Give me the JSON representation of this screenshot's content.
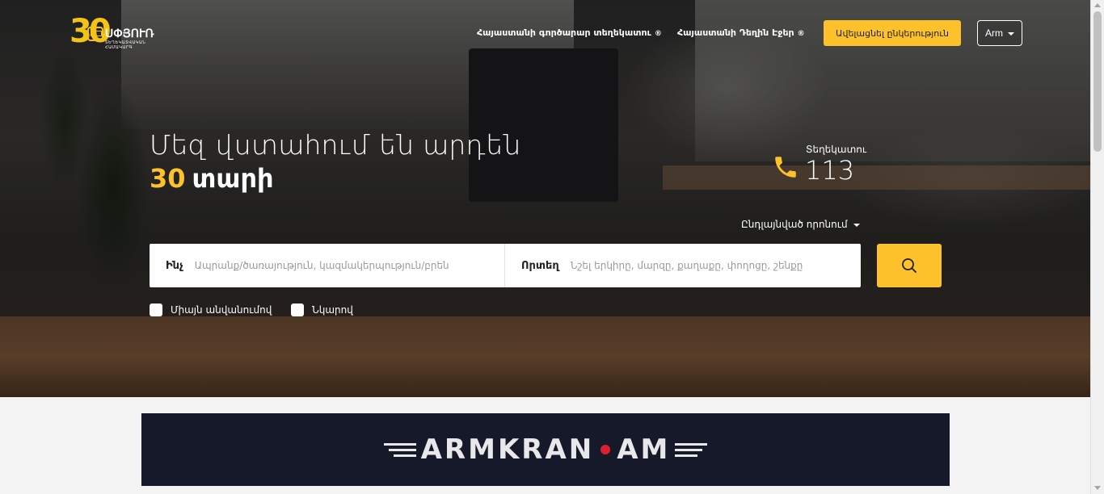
{
  "header": {
    "logo_number": "30",
    "logo_brand": "ՍՓՅՈՒՌ",
    "logo_tagline": "ՏԵՂԵԿԱՏՎԱԿԱՆ ՀԱՄԱԿԱՐԳ",
    "nav": [
      {
        "label": "Հայաստանի գործարար տեղեկատու",
        "suffix": "®"
      },
      {
        "label": "Հայաստանի Դեղին Էջեր",
        "suffix": "®"
      }
    ],
    "cta_label": "Ավելացնել ընկերություն",
    "language": "Arm"
  },
  "hero": {
    "headline_line1": "Մեզ վստահում են արդեն",
    "headline_number": "30",
    "headline_word": "տարի",
    "info_label": "Տեղեկատու",
    "info_number": "113",
    "advanced_search": "Ընդլայնված որոնում"
  },
  "search": {
    "what_label": "Ինչ",
    "what_placeholder": "Ապրանք/ծառայություն, կազմակերպություն/բրեն",
    "where_label": "Որտեղ",
    "where_placeholder": "Նշել երկիրը, մարզը, քաղաքը, փողոցը, շենքը"
  },
  "filters": [
    {
      "label": "Միայն անվանումով",
      "checked": false
    },
    {
      "label": "Նկարով",
      "checked": false
    }
  ],
  "banner": {
    "left": "ARMKRAN",
    "right": "AM"
  },
  "colors": {
    "accent": "#fdc22b",
    "banner_bg": "#15192a",
    "banner_dot": "#e01e2c"
  }
}
